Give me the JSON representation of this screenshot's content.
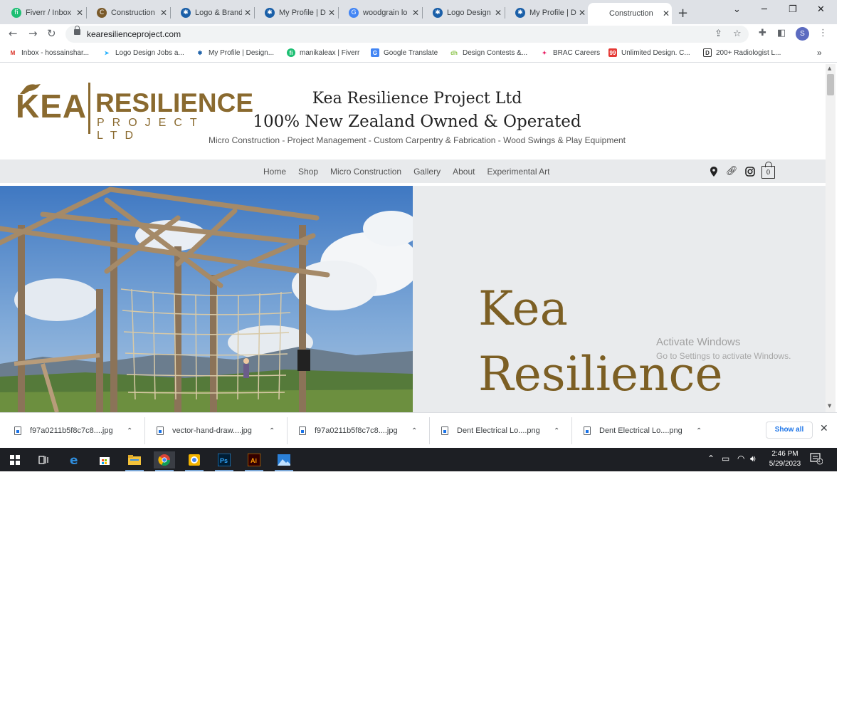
{
  "tabs": [
    {
      "title": "Fiverr / Inbox",
      "icon": "fiverr-icon",
      "color": "#1dbf73",
      "glyph": "fi"
    },
    {
      "title": "Construction",
      "icon": "construction-icon",
      "color": "#7a5a2a",
      "glyph": "C"
    },
    {
      "title": "Logo & Brand",
      "icon": "designhill-icon",
      "color": "#1a5fa8",
      "glyph": "✱"
    },
    {
      "title": "My Profile | D",
      "icon": "designhill-icon",
      "color": "#1a5fa8",
      "glyph": "✱"
    },
    {
      "title": "woodgrain lo",
      "icon": "google-icon",
      "color": "#4285f4",
      "glyph": "G"
    },
    {
      "title": "Logo Design",
      "icon": "designhill-icon",
      "color": "#1a5fa8",
      "glyph": "✱"
    },
    {
      "title": "My Profile | D",
      "icon": "designcontest-icon",
      "color": "#1a5fa8",
      "glyph": "✱"
    },
    {
      "title": "Construction",
      "icon": "none",
      "color": "#ffffff",
      "glyph": ""
    }
  ],
  "url": "kearesilienceproject.com",
  "profile_initial": "S",
  "bookmarks": [
    {
      "label": "Inbox - hossainshar...",
      "icon": "gmail-icon",
      "color": "#d93025",
      "glyph": "M"
    },
    {
      "label": "Logo Design Jobs a...",
      "icon": "freelancer-icon",
      "color": "#29b2fe",
      "glyph": "➤"
    },
    {
      "label": "My Profile | Design...",
      "icon": "designhill-icon",
      "color": "#1a5fa8",
      "glyph": "✱"
    },
    {
      "label": "manikaleax | Fiverr",
      "icon": "fiverr-icon",
      "color": "#1dbf73",
      "glyph": "fi"
    },
    {
      "label": "Google Translate",
      "icon": "translate-icon",
      "color": "#4285f4",
      "glyph": "G"
    },
    {
      "label": "Design Contests &...",
      "icon": "designhill-icon",
      "color": "#8bc34a",
      "glyph": "dh"
    },
    {
      "label": "BRAC Careers",
      "icon": "brac-icon",
      "color": "#e91e63",
      "glyph": "✦"
    },
    {
      "label": "Unlimited Design. C...",
      "icon": "99designs-icon",
      "color": "#e53935",
      "glyph": "99"
    },
    {
      "label": "200+ Radiologist L...",
      "icon": "radiologist-icon",
      "color": "#333333",
      "glyph": "D"
    }
  ],
  "site": {
    "logo": {
      "kea": "KEA",
      "resilience": "RESILIENCE",
      "project": "PROJECT LTD"
    },
    "title": "Kea Resilience Project Ltd",
    "subtitle": "100% New Zealand Owned & Operated",
    "services": "Micro Construction - Project Management - Custom Carpentry & Fabrication - Wood Swings & Play Equipment",
    "nav": [
      "Home",
      "Shop",
      "Micro Construction",
      "Gallery",
      "About",
      "Experimental Art"
    ],
    "cart_count": "0",
    "hero_line1": "Kea",
    "hero_line2": "Resilience",
    "brand_color": "#8a6a2f"
  },
  "watermark": {
    "line1": "Activate Windows",
    "line2": "Go to Settings to activate Windows."
  },
  "downloads": [
    {
      "name": "f97a0211b5f8c7c8....jpg"
    },
    {
      "name": "vector-hand-draw....jpg"
    },
    {
      "name": "f97a0211b5f8c7c8....jpg"
    },
    {
      "name": "Dent Electrical Lo....png"
    },
    {
      "name": "Dent Electrical Lo....png"
    }
  ],
  "show_all": "Show all",
  "clock": {
    "time": "2:46 PM",
    "date": "5/29/2023"
  },
  "notification_count": "1"
}
